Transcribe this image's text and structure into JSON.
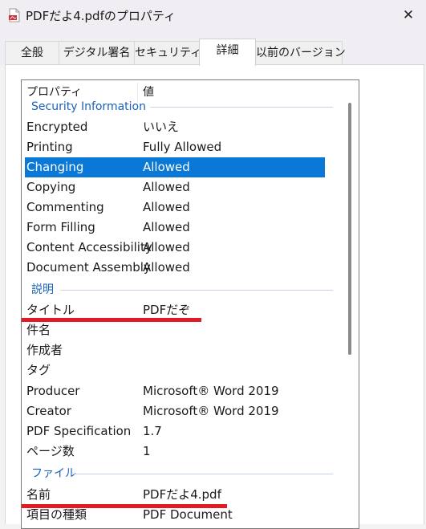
{
  "window": {
    "title": "PDFだよ4.pdfのプロパティ",
    "close_glyph": "✕"
  },
  "tabs": [
    {
      "label": "全般"
    },
    {
      "label": "デジタル署名"
    },
    {
      "label": "セキュリティ"
    },
    {
      "label": "詳細",
      "active": true
    },
    {
      "label": "以前のバージョン"
    }
  ],
  "columns": {
    "property": "プロパティ",
    "value": "値"
  },
  "groups": {
    "security": "Security Information",
    "description": "説明",
    "file": "ファイル"
  },
  "rows": [
    {
      "name": "Encrypted",
      "value": "いいえ"
    },
    {
      "name": "Printing",
      "value": "Fully Allowed"
    },
    {
      "name": "Changing",
      "value": "Allowed",
      "selected": true
    },
    {
      "name": "Copying",
      "value": "Allowed"
    },
    {
      "name": "Commenting",
      "value": "Allowed"
    },
    {
      "name": "Form Filling",
      "value": "Allowed"
    },
    {
      "name": "Content Accessibility",
      "value": "Allowed"
    },
    {
      "name": "Document Assembly",
      "value": "Allowed"
    },
    {
      "name": "タイトル",
      "value": "PDFだぞ"
    },
    {
      "name": "件名",
      "value": ""
    },
    {
      "name": "作成者",
      "value": ""
    },
    {
      "name": "タグ",
      "value": ""
    },
    {
      "name": "Producer",
      "value": "Microsoft® Word 2019"
    },
    {
      "name": "Creator",
      "value": "Microsoft® Word 2019"
    },
    {
      "name": "PDF Specification",
      "value": "1.7"
    },
    {
      "name": "ページ数",
      "value": "1"
    },
    {
      "name": "名前",
      "value": "PDFだよ4.pdf"
    },
    {
      "name": "項目の種類",
      "value": "PDF Document"
    }
  ],
  "colors": {
    "selection": "#0a78d7",
    "group_header": "#1a63b8",
    "annotation_underline": "#e01b24"
  }
}
